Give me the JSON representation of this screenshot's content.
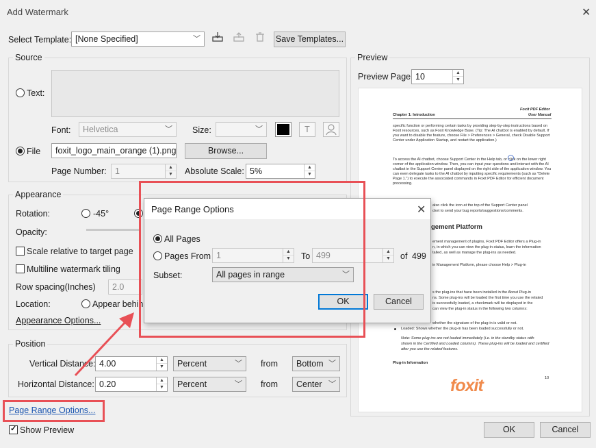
{
  "window": {
    "title": "Add Watermark",
    "close_icon": "close-icon"
  },
  "template": {
    "label": "Select Template:",
    "value": "[None Specified]",
    "save_label": "Save Templates..."
  },
  "source": {
    "title": "Source",
    "text_radio": "Text:",
    "font_label": "Font:",
    "font_value": "Helvetica",
    "size_label": "Size:",
    "file_radio": "File",
    "file_value": "foxit_logo_main_orange (1).png",
    "browse_label": "Browse...",
    "page_number_label": "Page Number:",
    "page_number_value": "1",
    "abs_scale_label": "Absolute Scale:",
    "abs_scale_value": "5%"
  },
  "appearance": {
    "title": "Appearance",
    "rotation_label": "Rotation:",
    "rotation_neg45": "-45°",
    "opacity_label": "Opacity:",
    "scale_relative_label": "Scale relative to target page",
    "multiline_label": "Multiline watermark tiling",
    "row_spacing_label": "Row spacing(Inches)",
    "row_spacing_value": "2.0",
    "location_label": "Location:",
    "appear_behind_label": "Appear behin",
    "options_link": "Appearance Options..."
  },
  "position": {
    "title": "Position",
    "vertical_label": "Vertical Distance:",
    "vertical_value": "4.00",
    "vertical_unit": "Percent",
    "vertical_from_label": "from",
    "vertical_from_value": "Bottom",
    "horizontal_label": "Horizontal Distance:",
    "horizontal_value": "0.20",
    "horizontal_unit": "Percent",
    "horizontal_from_label": "from",
    "horizontal_from_value": "Center"
  },
  "footer": {
    "page_range_link": "Page Range Options...",
    "show_preview_label": "Show Preview",
    "ok_label": "OK",
    "cancel_label": "Cancel"
  },
  "preview": {
    "title": "Preview",
    "page_label": "Preview Page:",
    "page_value": "10",
    "doc": {
      "brand": "Foxit PDF Editor",
      "manual": "User Manual",
      "chapter": "Chapter 1: Introduction",
      "p1": "specific function or performing certain tasks by providing step-by-step instructions based on Foxit resources, such as Foxit Knowledge Base. (Tip: The AI chatbot is enabled by default. If you want to disable the feature, choose File > Preferences > General, check Disable Support Center under Application Startup, and restart the application.)",
      "p2": "To access the AI chatbot, choose Support Center in the Help tab, or click      on the lower right corner of the application window. Then, you can input your questions and interact with the AI chatbot in the Support Center panel displayed on the right side of the application window. You can even delegate tasks to the AI chatbot by inputting specific requirements (such as \"Delete Page 1.\") to execute the associated commands in Foxit PDF Editor for efficient document processing.",
      "p3a": "also click the      icon at the top of the Support Center panel",
      "p3b": "cket to send your bug reports/suggestions/comments.",
      "heading": "gement Platform",
      "p4a": "ement management of plugins, Foxit PDF Editor offers a Plug-in",
      "p4b": "n, in which you can view the plug-in status, learn the information",
      "p4c": "talled, as well as manage the plug-ins as needed.",
      "p5a": "in Management Platform, please choose Help > Plug-in",
      "p6a": "s the plug-ins that have been installed in the About Plug-in",
      "p6b": "ns. Some plug-ins will be loaded the first time you use the related",
      "p6c": "is successfully loaded, a checkmark will be displayed in the",
      "p6d": "can view the plug-in status in the following two columns:",
      "bullet1": "whether the signature of the plug-in is valid or not.",
      "bullet2": "Loaded: Shows whether the plug-in has been loaded successfully or not.",
      "note1": "Note: Some plug-ins are not loaded immediately (i.e. in the standby status with",
      "note2": "shown in the Certified and Loaded columns). These plug-ins will be loaded and certified",
      "note3": "after you use the related features.",
      "plugin_info": "Plug-in Information",
      "page_num": "10",
      "logo_text": "foxit"
    }
  },
  "page_range_dialog": {
    "title": "Page Range Options",
    "all_pages_label": "All Pages",
    "pages_from_label": "Pages From",
    "from_value": "1",
    "to_label": "To",
    "to_value": "499",
    "of_label": "of",
    "total_pages": "499",
    "subset_label": "Subset:",
    "subset_value": "All pages in range",
    "ok_label": "OK",
    "cancel_label": "Cancel"
  },
  "colors": {
    "annotation": "#e85056",
    "foxit_logo": "#f08a4b",
    "link": "#1a55b0",
    "focus": "#0078d7"
  }
}
